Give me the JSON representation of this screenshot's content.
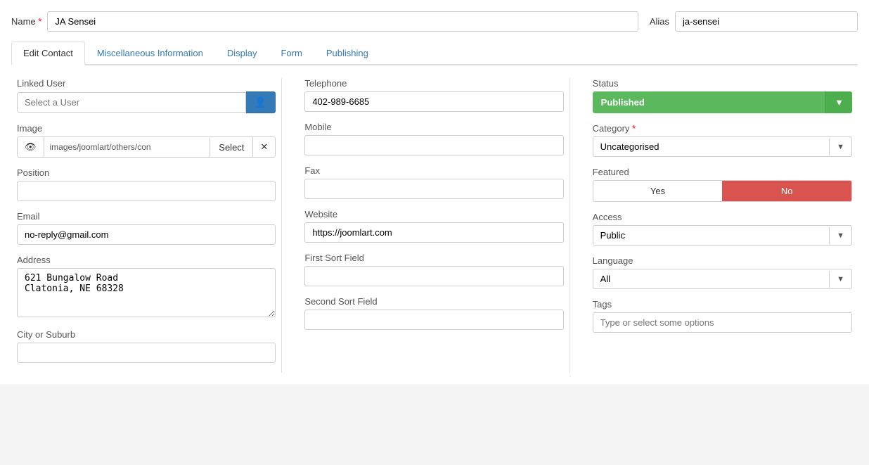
{
  "header": {
    "name_label": "Name",
    "name_required": "*",
    "name_value": "JA Sensei",
    "alias_label": "Alias",
    "alias_value": "ja-sensei"
  },
  "tabs": [
    {
      "id": "edit-contact",
      "label": "Edit Contact",
      "active": true
    },
    {
      "id": "misc-info",
      "label": "Miscellaneous Information",
      "active": false
    },
    {
      "id": "display",
      "label": "Display",
      "active": false
    },
    {
      "id": "form",
      "label": "Form",
      "active": false
    },
    {
      "id": "publishing",
      "label": "Publishing",
      "active": false
    }
  ],
  "left_col": {
    "linked_user_label": "Linked User",
    "linked_user_placeholder": "Select a User",
    "image_label": "Image",
    "image_path": "images/joomlart/others/con",
    "select_label": "Select",
    "position_label": "Position",
    "position_value": "",
    "email_label": "Email",
    "email_value": "no-reply@gmail.com",
    "address_label": "Address",
    "address_value": "621 Bungalow Road\nClatonia, NE 68328",
    "city_label": "City or Suburb"
  },
  "mid_col": {
    "telephone_label": "Telephone",
    "telephone_value": "402-989-6685",
    "mobile_label": "Mobile",
    "mobile_value": "",
    "fax_label": "Fax",
    "fax_value": "",
    "website_label": "Website",
    "website_value": "https://joomlart.com",
    "first_sort_label": "First Sort Field",
    "first_sort_value": "",
    "second_sort_label": "Second Sort Field",
    "second_sort_value": ""
  },
  "right_col": {
    "status_label": "Status",
    "status_value": "Published",
    "category_label": "Category",
    "category_required": "*",
    "category_value": "Uncategorised",
    "featured_label": "Featured",
    "featured_yes": "Yes",
    "featured_no": "No",
    "access_label": "Access",
    "access_value": "Public",
    "language_label": "Language",
    "language_value": "All",
    "tags_label": "Tags",
    "tags_placeholder": "Type or select some options"
  },
  "colors": {
    "published_bg": "#5cb85c",
    "published_arrow": "#4cae4c",
    "featured_no_bg": "#d9534f",
    "link_color": "#337ab7",
    "user_btn_bg": "#337ab7"
  }
}
